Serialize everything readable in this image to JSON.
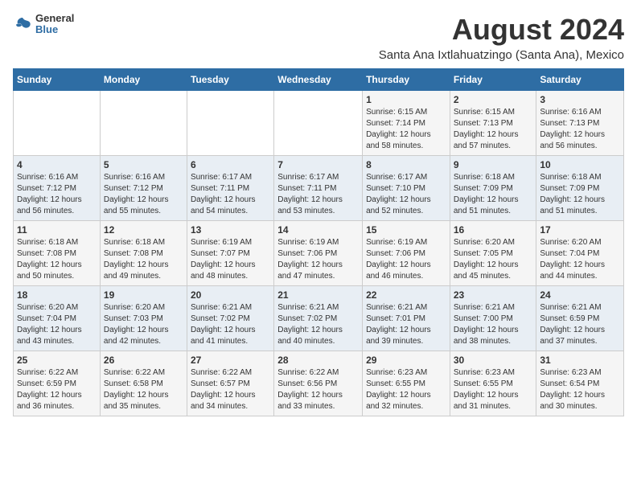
{
  "header": {
    "logo_general": "General",
    "logo_blue": "Blue",
    "month_year": "August 2024",
    "location": "Santa Ana Ixtlahuatzingo (Santa Ana), Mexico"
  },
  "days_of_week": [
    "Sunday",
    "Monday",
    "Tuesday",
    "Wednesday",
    "Thursday",
    "Friday",
    "Saturday"
  ],
  "weeks": [
    [
      {
        "day": "",
        "info": ""
      },
      {
        "day": "",
        "info": ""
      },
      {
        "day": "",
        "info": ""
      },
      {
        "day": "",
        "info": ""
      },
      {
        "day": "1",
        "info": "Sunrise: 6:15 AM\nSunset: 7:14 PM\nDaylight: 12 hours\nand 58 minutes."
      },
      {
        "day": "2",
        "info": "Sunrise: 6:15 AM\nSunset: 7:13 PM\nDaylight: 12 hours\nand 57 minutes."
      },
      {
        "day": "3",
        "info": "Sunrise: 6:16 AM\nSunset: 7:13 PM\nDaylight: 12 hours\nand 56 minutes."
      }
    ],
    [
      {
        "day": "4",
        "info": "Sunrise: 6:16 AM\nSunset: 7:12 PM\nDaylight: 12 hours\nand 56 minutes."
      },
      {
        "day": "5",
        "info": "Sunrise: 6:16 AM\nSunset: 7:12 PM\nDaylight: 12 hours\nand 55 minutes."
      },
      {
        "day": "6",
        "info": "Sunrise: 6:17 AM\nSunset: 7:11 PM\nDaylight: 12 hours\nand 54 minutes."
      },
      {
        "day": "7",
        "info": "Sunrise: 6:17 AM\nSunset: 7:11 PM\nDaylight: 12 hours\nand 53 minutes."
      },
      {
        "day": "8",
        "info": "Sunrise: 6:17 AM\nSunset: 7:10 PM\nDaylight: 12 hours\nand 52 minutes."
      },
      {
        "day": "9",
        "info": "Sunrise: 6:18 AM\nSunset: 7:09 PM\nDaylight: 12 hours\nand 51 minutes."
      },
      {
        "day": "10",
        "info": "Sunrise: 6:18 AM\nSunset: 7:09 PM\nDaylight: 12 hours\nand 51 minutes."
      }
    ],
    [
      {
        "day": "11",
        "info": "Sunrise: 6:18 AM\nSunset: 7:08 PM\nDaylight: 12 hours\nand 50 minutes."
      },
      {
        "day": "12",
        "info": "Sunrise: 6:18 AM\nSunset: 7:08 PM\nDaylight: 12 hours\nand 49 minutes."
      },
      {
        "day": "13",
        "info": "Sunrise: 6:19 AM\nSunset: 7:07 PM\nDaylight: 12 hours\nand 48 minutes."
      },
      {
        "day": "14",
        "info": "Sunrise: 6:19 AM\nSunset: 7:06 PM\nDaylight: 12 hours\nand 47 minutes."
      },
      {
        "day": "15",
        "info": "Sunrise: 6:19 AM\nSunset: 7:06 PM\nDaylight: 12 hours\nand 46 minutes."
      },
      {
        "day": "16",
        "info": "Sunrise: 6:20 AM\nSunset: 7:05 PM\nDaylight: 12 hours\nand 45 minutes."
      },
      {
        "day": "17",
        "info": "Sunrise: 6:20 AM\nSunset: 7:04 PM\nDaylight: 12 hours\nand 44 minutes."
      }
    ],
    [
      {
        "day": "18",
        "info": "Sunrise: 6:20 AM\nSunset: 7:04 PM\nDaylight: 12 hours\nand 43 minutes."
      },
      {
        "day": "19",
        "info": "Sunrise: 6:20 AM\nSunset: 7:03 PM\nDaylight: 12 hours\nand 42 minutes."
      },
      {
        "day": "20",
        "info": "Sunrise: 6:21 AM\nSunset: 7:02 PM\nDaylight: 12 hours\nand 41 minutes."
      },
      {
        "day": "21",
        "info": "Sunrise: 6:21 AM\nSunset: 7:02 PM\nDaylight: 12 hours\nand 40 minutes."
      },
      {
        "day": "22",
        "info": "Sunrise: 6:21 AM\nSunset: 7:01 PM\nDaylight: 12 hours\nand 39 minutes."
      },
      {
        "day": "23",
        "info": "Sunrise: 6:21 AM\nSunset: 7:00 PM\nDaylight: 12 hours\nand 38 minutes."
      },
      {
        "day": "24",
        "info": "Sunrise: 6:21 AM\nSunset: 6:59 PM\nDaylight: 12 hours\nand 37 minutes."
      }
    ],
    [
      {
        "day": "25",
        "info": "Sunrise: 6:22 AM\nSunset: 6:59 PM\nDaylight: 12 hours\nand 36 minutes."
      },
      {
        "day": "26",
        "info": "Sunrise: 6:22 AM\nSunset: 6:58 PM\nDaylight: 12 hours\nand 35 minutes."
      },
      {
        "day": "27",
        "info": "Sunrise: 6:22 AM\nSunset: 6:57 PM\nDaylight: 12 hours\nand 34 minutes."
      },
      {
        "day": "28",
        "info": "Sunrise: 6:22 AM\nSunset: 6:56 PM\nDaylight: 12 hours\nand 33 minutes."
      },
      {
        "day": "29",
        "info": "Sunrise: 6:23 AM\nSunset: 6:55 PM\nDaylight: 12 hours\nand 32 minutes."
      },
      {
        "day": "30",
        "info": "Sunrise: 6:23 AM\nSunset: 6:55 PM\nDaylight: 12 hours\nand 31 minutes."
      },
      {
        "day": "31",
        "info": "Sunrise: 6:23 AM\nSunset: 6:54 PM\nDaylight: 12 hours\nand 30 minutes."
      }
    ]
  ]
}
